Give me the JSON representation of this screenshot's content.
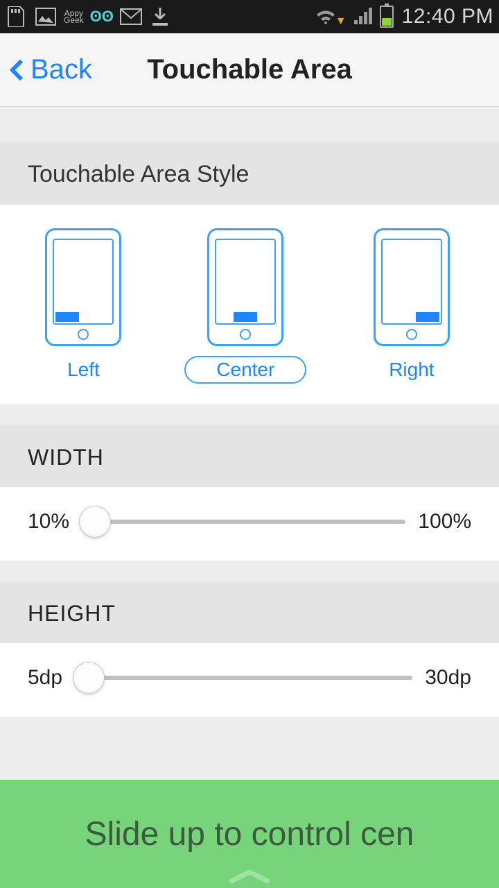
{
  "status_bar": {
    "time": "12:40 PM",
    "appy_label": "Appy\nGeek"
  },
  "header": {
    "back_label": "Back",
    "title": "Touchable Area"
  },
  "style_section": {
    "header": "Touchable Area Style",
    "options": {
      "left": "Left",
      "center": "Center",
      "right": "Right"
    },
    "selected": "center"
  },
  "width_section": {
    "header": "WIDTH",
    "min": "10%",
    "max": "100%"
  },
  "height_section": {
    "header": "HEIGHT",
    "min": "5dp",
    "max": "30dp"
  },
  "banner": {
    "text": "Slide up to control cen"
  }
}
